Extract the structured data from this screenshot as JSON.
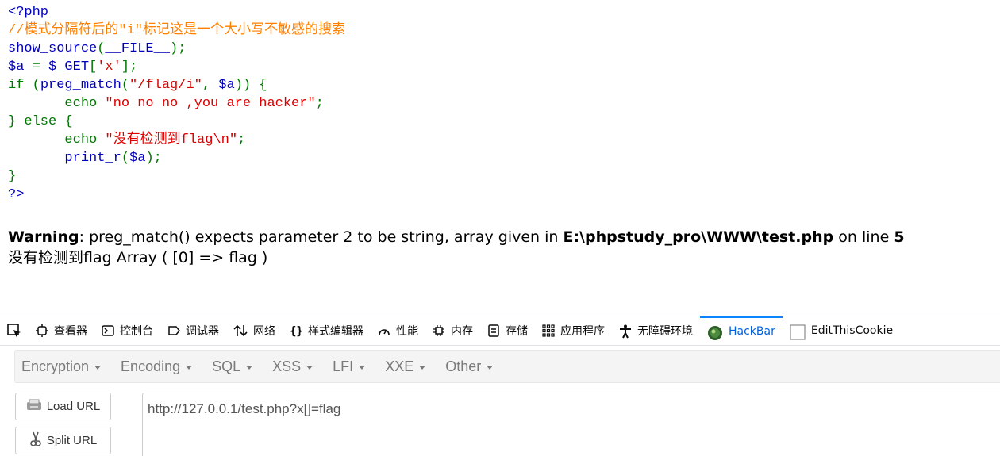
{
  "code": {
    "lines": [
      [
        {
          "t": "<?php",
          "c": "default"
        }
      ],
      [
        {
          "t": "//模式分隔符后的\"i\"标记这是一个大小写不敏感的搜索",
          "c": "comment"
        }
      ],
      [
        {
          "t": "show_source",
          "c": "default"
        },
        {
          "t": "(",
          "c": "kw"
        },
        {
          "t": "__FILE__",
          "c": "default"
        },
        {
          "t": ");",
          "c": "kw"
        }
      ],
      [
        {
          "t": "$a ",
          "c": "default"
        },
        {
          "t": "= ",
          "c": "kw"
        },
        {
          "t": "$_GET",
          "c": "default"
        },
        {
          "t": "[",
          "c": "kw"
        },
        {
          "t": "'x'",
          "c": "str"
        },
        {
          "t": "];",
          "c": "kw"
        }
      ],
      [
        {
          "t": "if ",
          "c": "kw"
        },
        {
          "t": "(",
          "c": "kw"
        },
        {
          "t": "preg_match",
          "c": "default"
        },
        {
          "t": "(",
          "c": "kw"
        },
        {
          "t": "\"/flag/i\"",
          "c": "str"
        },
        {
          "t": ", ",
          "c": "kw"
        },
        {
          "t": "$a",
          "c": "default"
        },
        {
          "t": ")) {",
          "c": "kw"
        }
      ],
      [
        {
          "t": "       echo ",
          "c": "kw"
        },
        {
          "t": "\"no no no ,you are hacker\"",
          "c": "str"
        },
        {
          "t": ";",
          "c": "kw"
        }
      ],
      [
        {
          "t": "} else {",
          "c": "kw"
        }
      ],
      [
        {
          "t": "       echo ",
          "c": "kw"
        },
        {
          "t": "\"没有检测到flag\\n\"",
          "c": "str"
        },
        {
          "t": ";",
          "c": "kw"
        }
      ],
      [
        {
          "t": "       print_r",
          "c": "default"
        },
        {
          "t": "(",
          "c": "kw"
        },
        {
          "t": "$a",
          "c": "default"
        },
        {
          "t": ");",
          "c": "kw"
        }
      ],
      [
        {
          "t": "}",
          "c": "kw"
        }
      ],
      [
        {
          "t": "?>",
          "c": "default"
        }
      ]
    ]
  },
  "output": {
    "warning_label": "Warning",
    "warning_msg": ": preg_match() expects parameter 2 to be string, array given in ",
    "warning_path": "E:\\phpstudy_pro\\WWW\\test.php",
    "warning_online": " on line ",
    "warning_line": "5",
    "result": "没有检测到flag Array ( [0] => flag )"
  },
  "devtools": {
    "tabs": [
      {
        "label": "查看器",
        "icon": "inspector-icon"
      },
      {
        "label": "控制台",
        "icon": "console-icon"
      },
      {
        "label": "调试器",
        "icon": "debugger-icon"
      },
      {
        "label": "网络",
        "icon": "network-icon"
      },
      {
        "label": "样式编辑器",
        "icon": "style-editor-icon"
      },
      {
        "label": "性能",
        "icon": "performance-icon"
      },
      {
        "label": "内存",
        "icon": "memory-icon"
      },
      {
        "label": "存储",
        "icon": "storage-icon"
      },
      {
        "label": "应用程序",
        "icon": "application-icon"
      },
      {
        "label": "无障碍环境",
        "icon": "accessibility-icon"
      },
      {
        "label": "HackBar",
        "icon": "hackbar-icon",
        "active": true
      },
      {
        "label": "EditThisCookie",
        "icon": "cookie-checkbox-icon"
      }
    ],
    "accent": "#0a84ff"
  },
  "hackbar": {
    "menus": [
      "Encryption",
      "Encoding",
      "SQL",
      "XSS",
      "LFI",
      "XXE",
      "Other"
    ],
    "load_url": "Load URL",
    "split_url": "Split URL",
    "url": "http://127.0.0.1/test.php?x[]=flag"
  },
  "colors": {
    "php_default": "#0000bb",
    "php_comment": "#ff8000",
    "php_keyword": "#007700",
    "php_string": "#dd0000"
  }
}
